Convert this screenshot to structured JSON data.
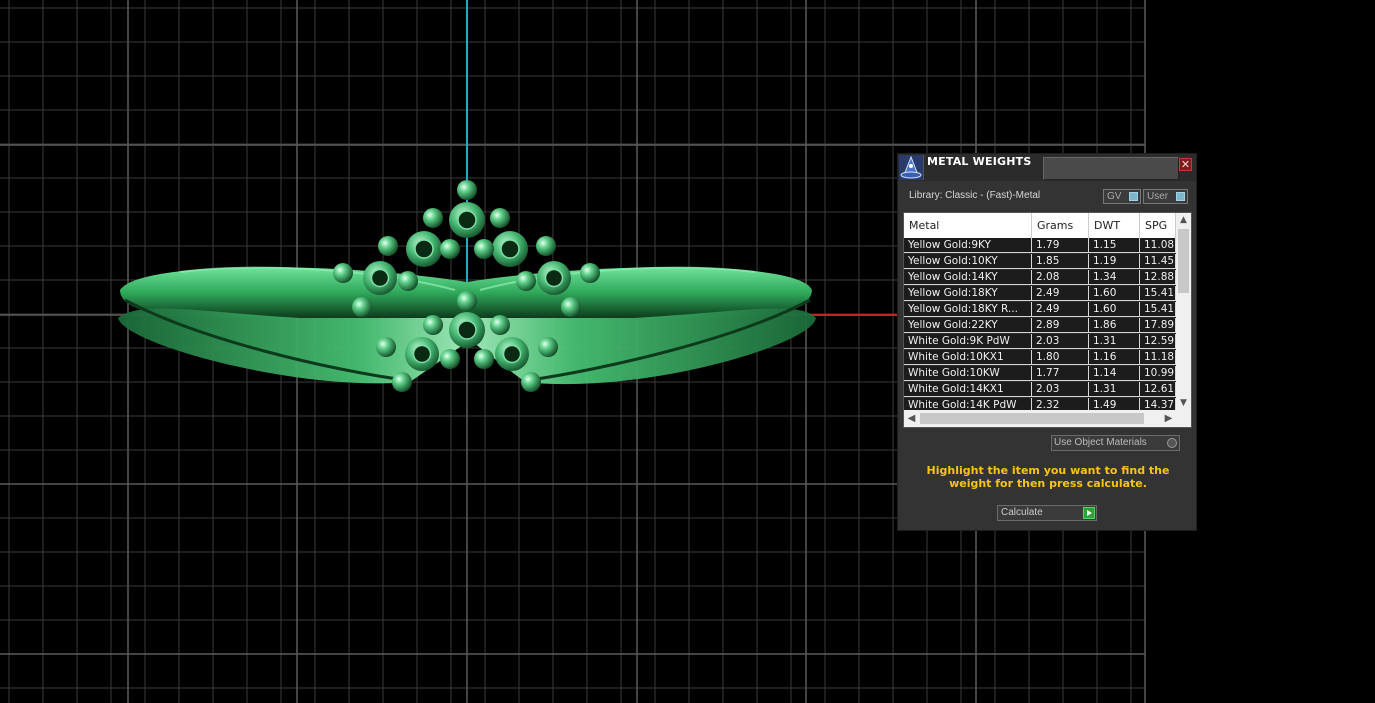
{
  "panel": {
    "title": "METAL WEIGHTS",
    "close_glyph": "✕",
    "library_label": "Library: Classic - (Fast)-Metal",
    "toggle_gv": "GV",
    "toggle_user": "User",
    "columns": [
      "Metal",
      "Grams",
      "DWT",
      "SPG"
    ],
    "rows": [
      [
        "Yellow Gold:9KY",
        "1.79",
        "1.15",
        "11.08"
      ],
      [
        "Yellow Gold:10KY",
        "1.85",
        "1.19",
        "11.45"
      ],
      [
        "Yellow Gold:14KY",
        "2.08",
        "1.34",
        "12.88"
      ],
      [
        "Yellow Gold:18KY",
        "2.49",
        "1.60",
        "15.41"
      ],
      [
        "Yellow Gold:18KY R...",
        "2.49",
        "1.60",
        "15.41"
      ],
      [
        "Yellow Gold:22KY",
        "2.89",
        "1.86",
        "17.89"
      ],
      [
        "White Gold:9K PdW",
        "2.03",
        "1.31",
        "12.59"
      ],
      [
        "White Gold:10KX1",
        "1.80",
        "1.16",
        "11.18"
      ],
      [
        "White Gold:10KW",
        "1.77",
        "1.14",
        "10.99"
      ],
      [
        "White Gold:14KX1",
        "2.03",
        "1.31",
        "12.61"
      ],
      [
        "White Gold:14K PdW",
        "2.32",
        "1.49",
        "14.37"
      ]
    ],
    "use_object_materials": "Use Object Materials",
    "hint": "Highlight the item you want to find the weight for then press calculate.",
    "calculate": "Calculate"
  },
  "icons": {
    "app_icon": "wizard-hat-icon",
    "close": "close-icon",
    "scroll_up": "chevron-up-icon",
    "scroll_down": "chevron-down-icon",
    "scroll_left": "chevron-left-icon",
    "scroll_right": "chevron-right-icon",
    "play": "play-icon"
  },
  "colors": {
    "model": "#3fbf6a",
    "hint_text": "#f5c518",
    "grid": "#5a5a5a",
    "axis_vertical": "#2aa8c8",
    "axis_horizontal": "#c0281e"
  }
}
